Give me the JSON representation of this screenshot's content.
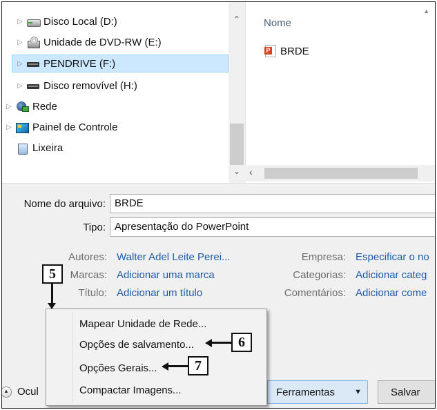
{
  "nav_tree": {
    "items": [
      {
        "label": "Disco Local (D:)"
      },
      {
        "label": "Unidade de DVD-RW (E:)"
      },
      {
        "label": "PENDRIVE (F:)"
      },
      {
        "label": "Disco removível (H:)"
      },
      {
        "label": "Rede"
      },
      {
        "label": "Painel de Controle"
      },
      {
        "label": "Lixeira"
      }
    ],
    "selected_index": 2
  },
  "file_list": {
    "column_header": "Nome",
    "files": [
      {
        "name": "BRDE",
        "icon": "powerpoint-file-icon"
      }
    ]
  },
  "form": {
    "filename_label": "Nome do arquivo:",
    "filename_value": "BRDE",
    "type_label": "Tipo:",
    "type_value": "Apresentação do PowerPoint",
    "authors_label": "Autores:",
    "authors_value": "Walter Adel Leite Perei...",
    "tags_label": "Marcas:",
    "tags_value": "Adicionar uma marca",
    "title_label": "Título:",
    "title_value": "Adicionar um título",
    "company_label": "Empresa:",
    "company_value": "Especificar o no",
    "categories_label": "Categorias:",
    "categories_value": "Adicionar categ",
    "comments_label": "Comentários:",
    "comments_value": "Adicionar come"
  },
  "footer": {
    "hide_folders_label": "Ocul",
    "tools_label": "Ferramentas",
    "save_label": "Salvar"
  },
  "tools_menu": {
    "items": [
      {
        "label": "Mapear Unidade de Rede..."
      },
      {
        "label": "Opções de salvamento..."
      },
      {
        "label": "Opções Gerais..."
      },
      {
        "label": "Compactar Imagens..."
      }
    ]
  },
  "callouts": {
    "c5": "5",
    "c6": "6",
    "c7": "7"
  },
  "colors": {
    "selection": "#cce8ff",
    "link": "#1e5aa8",
    "dialog_bg": "#f0f0f0"
  }
}
